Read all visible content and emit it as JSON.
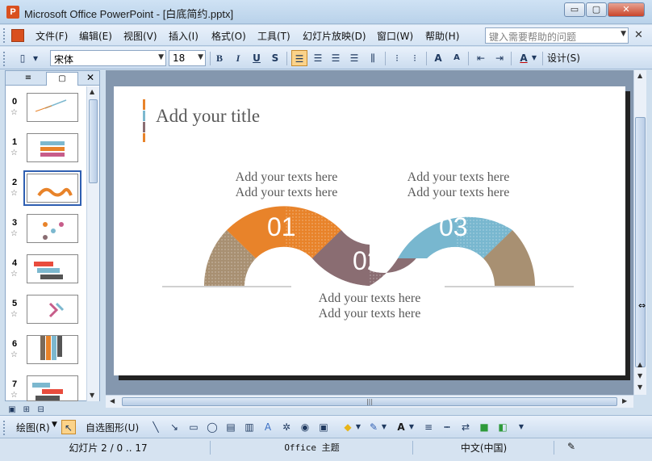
{
  "window": {
    "title": "Microsoft Office PowerPoint - [白底简约.pptx]",
    "app_icon": "powerpoint-icon",
    "min_label": "▭",
    "max_label": "▢",
    "close_label": "✕"
  },
  "menu": {
    "items": [
      "文件(F)",
      "编辑(E)",
      "视图(V)",
      "插入(I)",
      "格式(O)",
      "工具(T)",
      "幻灯片放映(D)",
      "窗口(W)",
      "帮助(H)"
    ],
    "help_placeholder": "键入需要帮助的问题"
  },
  "format_toolbar": {
    "font_name": "宋体",
    "font_size": "18",
    "bold": "B",
    "italic": "I",
    "underline": "U",
    "shadow": "S",
    "design_label": "设计(S)",
    "accent_active": "#fbd38a"
  },
  "slides_pane": {
    "tab_outline": "≡",
    "tab_slides": "▢",
    "close": "✕",
    "slides": [
      {
        "num": "0",
        "star": "☆"
      },
      {
        "num": "1",
        "star": "☆"
      },
      {
        "num": "2",
        "star": "☆"
      },
      {
        "num": "3",
        "star": "☆"
      },
      {
        "num": "4",
        "star": "☆"
      },
      {
        "num": "5",
        "star": "☆"
      },
      {
        "num": "6",
        "star": "☆"
      },
      {
        "num": "7",
        "star": "☆"
      }
    ],
    "selected_index": 2
  },
  "slide": {
    "title": "Add your title",
    "title_bar_colors": [
      "#e8832a",
      "#7cb8cf",
      "#8a6d72",
      "#e8832a"
    ],
    "blocks": {
      "top_left": [
        "Add your texts here",
        "Add your texts here"
      ],
      "top_right": [
        "Add your texts here",
        "Add your texts here"
      ],
      "bottom": [
        "Add your texts here",
        "Add your texts here"
      ]
    },
    "segments": [
      {
        "label": "01",
        "color": "#e8832a"
      },
      {
        "label": "02",
        "color": "#8a6d72"
      },
      {
        "label": "03",
        "color": "#78b7cf"
      }
    ],
    "end_color": "#a89072"
  },
  "draw_toolbar": {
    "draw_label": "绘图(R)",
    "autoshape_label": "自选图形(U)"
  },
  "status": {
    "slide_info": "幻灯片 2 / 0 .. 17",
    "theme": "Office 主题",
    "language": "中文(中国)"
  }
}
